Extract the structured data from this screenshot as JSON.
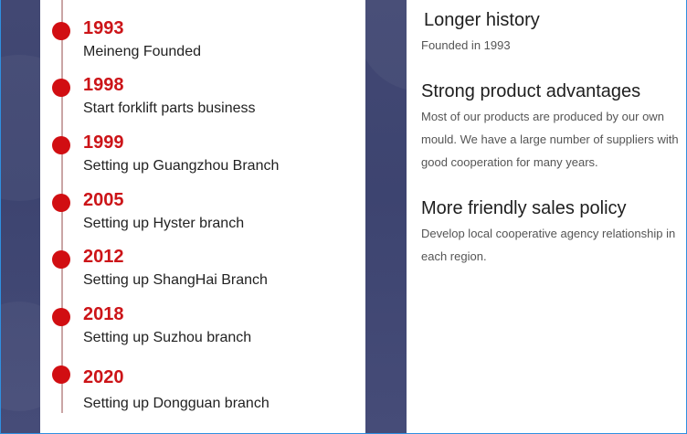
{
  "timeline": [
    {
      "year": "1993",
      "text": "Meineng Founded"
    },
    {
      "year": "1998",
      "text": "Start forklift parts business"
    },
    {
      "year": "1999",
      "text": "Setting up Guangzhou Branch"
    },
    {
      "year": "2005",
      "text": "Setting up Hyster branch"
    },
    {
      "year": "2012",
      "text": "Setting up ShangHai Branch"
    },
    {
      "year": "2018",
      "text": "Setting up Suzhou branch"
    },
    {
      "year": "2020",
      "text": "Setting up Dongguan branch"
    }
  ],
  "advantages": [
    {
      "title": "Longer history",
      "body": "Founded in 1993"
    },
    {
      "title": "Strong product advantages",
      "body": "Most of our products are produced by our own mould. We have a large number of suppliers with good cooperation for many years."
    },
    {
      "title": "More friendly sales policy",
      "body": "Develop local cooperative agency relationship in each region."
    }
  ],
  "colors": {
    "accent_red": "#d10e12",
    "banner_navy": "#424873",
    "frame_blue": "#2f8fe0"
  }
}
